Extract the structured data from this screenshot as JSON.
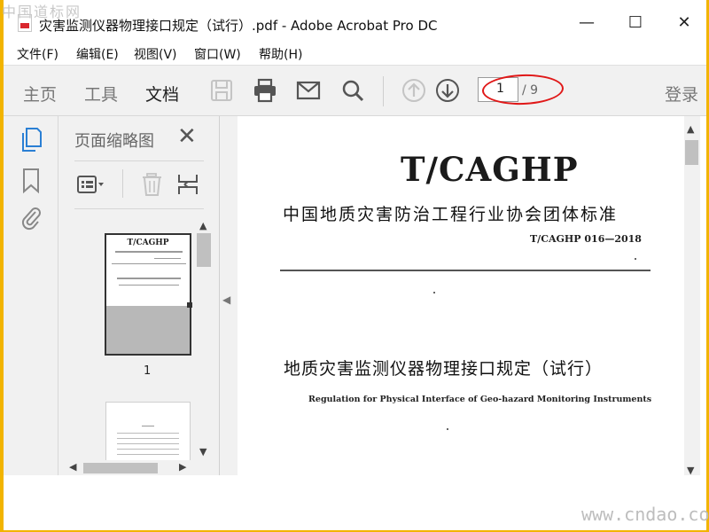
{
  "watermark": {
    "top": "中国道标网",
    "bottom": "www.cndao.com"
  },
  "window": {
    "title": "灾害监测仪器物理接口规定（试行）.pdf - Adobe Acrobat Pro DC",
    "minimize": "—",
    "maximize": "☐",
    "close": "✕"
  },
  "menu": [
    "文件(F)",
    "编辑(E)",
    "视图(V)",
    "窗口(W)",
    "帮助(H)"
  ],
  "toolbar": {
    "tabs": [
      "主页",
      "工具",
      "文档"
    ],
    "active_tab": "文档",
    "icons": [
      "save-icon",
      "print-icon",
      "email-icon",
      "search-icon",
      "prev-page-icon",
      "next-page-icon"
    ],
    "page_current": "1",
    "page_total": "/ 9",
    "login": "登录",
    "highlight_color": "#e01818"
  },
  "rail": {
    "icons": [
      "pages-icon",
      "bookmark-icon",
      "attachment-icon"
    ],
    "active_color": "#2a7fd4"
  },
  "thumbnail_panel": {
    "title": "页面缩略图",
    "close": "✕",
    "thumbnails": [
      {
        "label": "1",
        "title": "T/CAGHP"
      },
      {
        "label": ""
      }
    ]
  },
  "document": {
    "main_title": "T/CAGHP",
    "org": "中国地质灾害防治工程行业协会团体标准",
    "code": "T/CAGHP 016—2018",
    "cn_title": "地质灾害监测仪器物理接口规定（试行）",
    "en_title": "Regulation for Physical Interface of Geo-hazard Monitoring Instruments"
  }
}
